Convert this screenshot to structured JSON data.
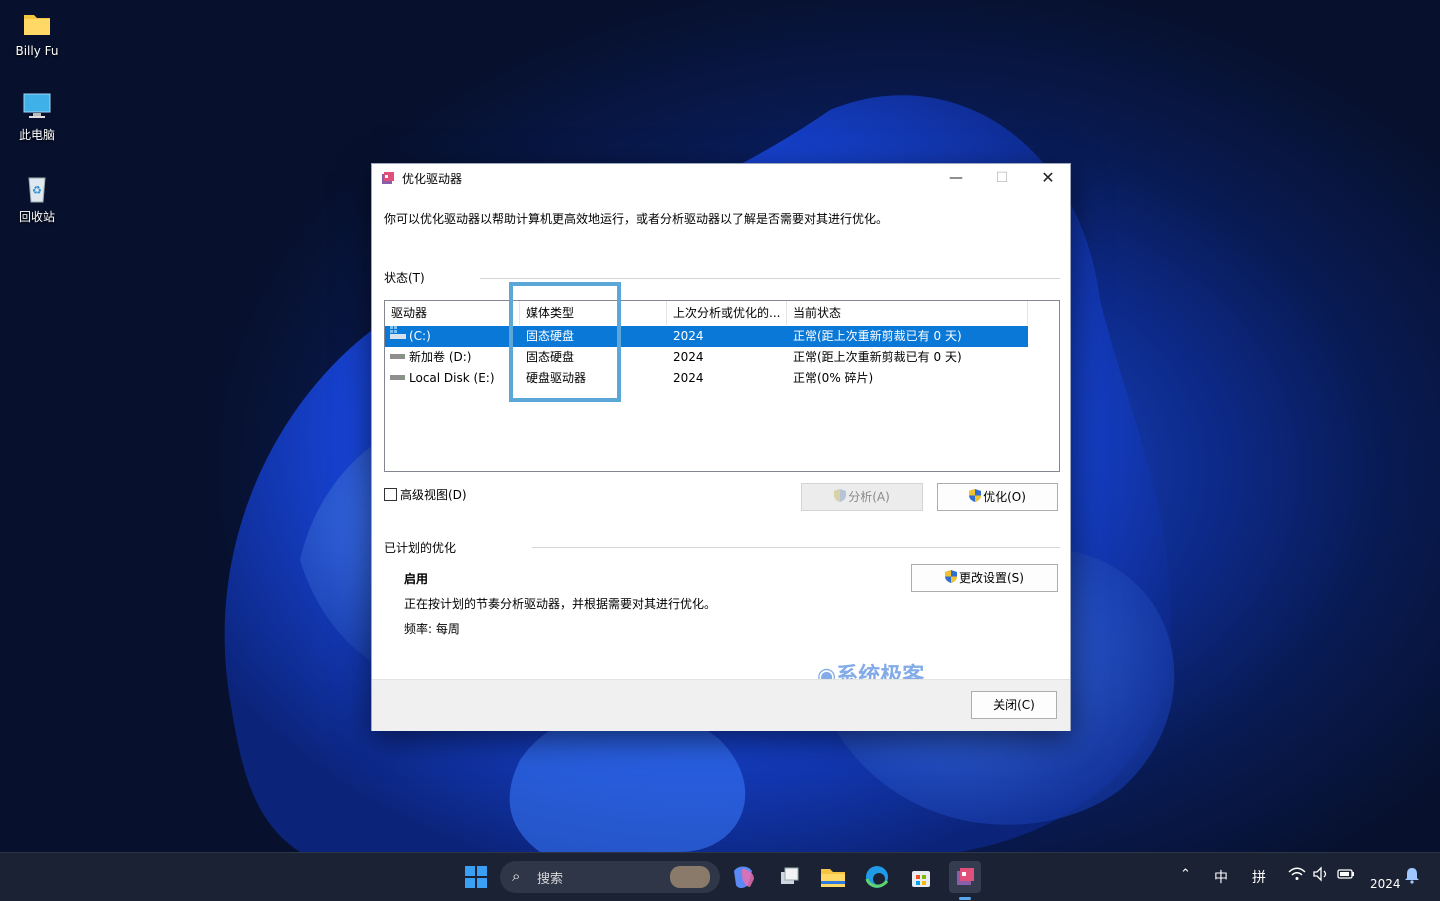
{
  "desktop": {
    "icons": [
      {
        "label": "Billy Fu",
        "icon": "folder-icon"
      },
      {
        "label": "此电脑",
        "icon": "computer-icon"
      },
      {
        "label": "回收站",
        "icon": "recycle-bin-icon"
      }
    ]
  },
  "window": {
    "title": "优化驱动器",
    "description": "你可以优化驱动器以帮助计算机更高效地运行，或者分析驱动器以了解是否需要对其进行优化。",
    "status_label": "状态(T)",
    "columns": [
      "驱动器",
      "媒体类型",
      "上次分析或优化的...",
      "当前状态"
    ],
    "drives": [
      {
        "name": "(C:)",
        "media": "固态硬盘",
        "last": "2024",
        "status": "正常(距上次重新剪裁已有 0 天)",
        "selected": true,
        "icon": "system-drive-icon"
      },
      {
        "name": "新加卷 (D:)",
        "media": "固态硬盘",
        "last": "2024",
        "status": "正常(距上次重新剪裁已有 0 天)",
        "selected": false,
        "icon": "drive-icon"
      },
      {
        "name": "Local Disk (E:)",
        "media": "硬盘驱动器",
        "last": "2024",
        "status": "正常(0% 碎片)",
        "selected": false,
        "icon": "drive-icon"
      }
    ],
    "advanced_view_label": "高级视图(D)",
    "analyze_button": "分析(A)",
    "optimize_button": "优化(O)",
    "scheduled_label": "已计划的优化",
    "schedule_status": "启用",
    "schedule_desc": "正在按计划的节奏分析驱动器，并根据需要对其进行优化。",
    "schedule_freq": "频率: 每周",
    "change_settings_button": "更改设置(S)",
    "close_button": "关闭(C)",
    "watermark": "系统极客"
  },
  "taskbar": {
    "search_placeholder": "搜索",
    "ime_lang": "中",
    "ime_mode": "拼",
    "clock": "2024"
  },
  "colors": {
    "selection": "#0a78d7",
    "highlight_box": "#5aa7d8",
    "accent": "#0078d4"
  }
}
